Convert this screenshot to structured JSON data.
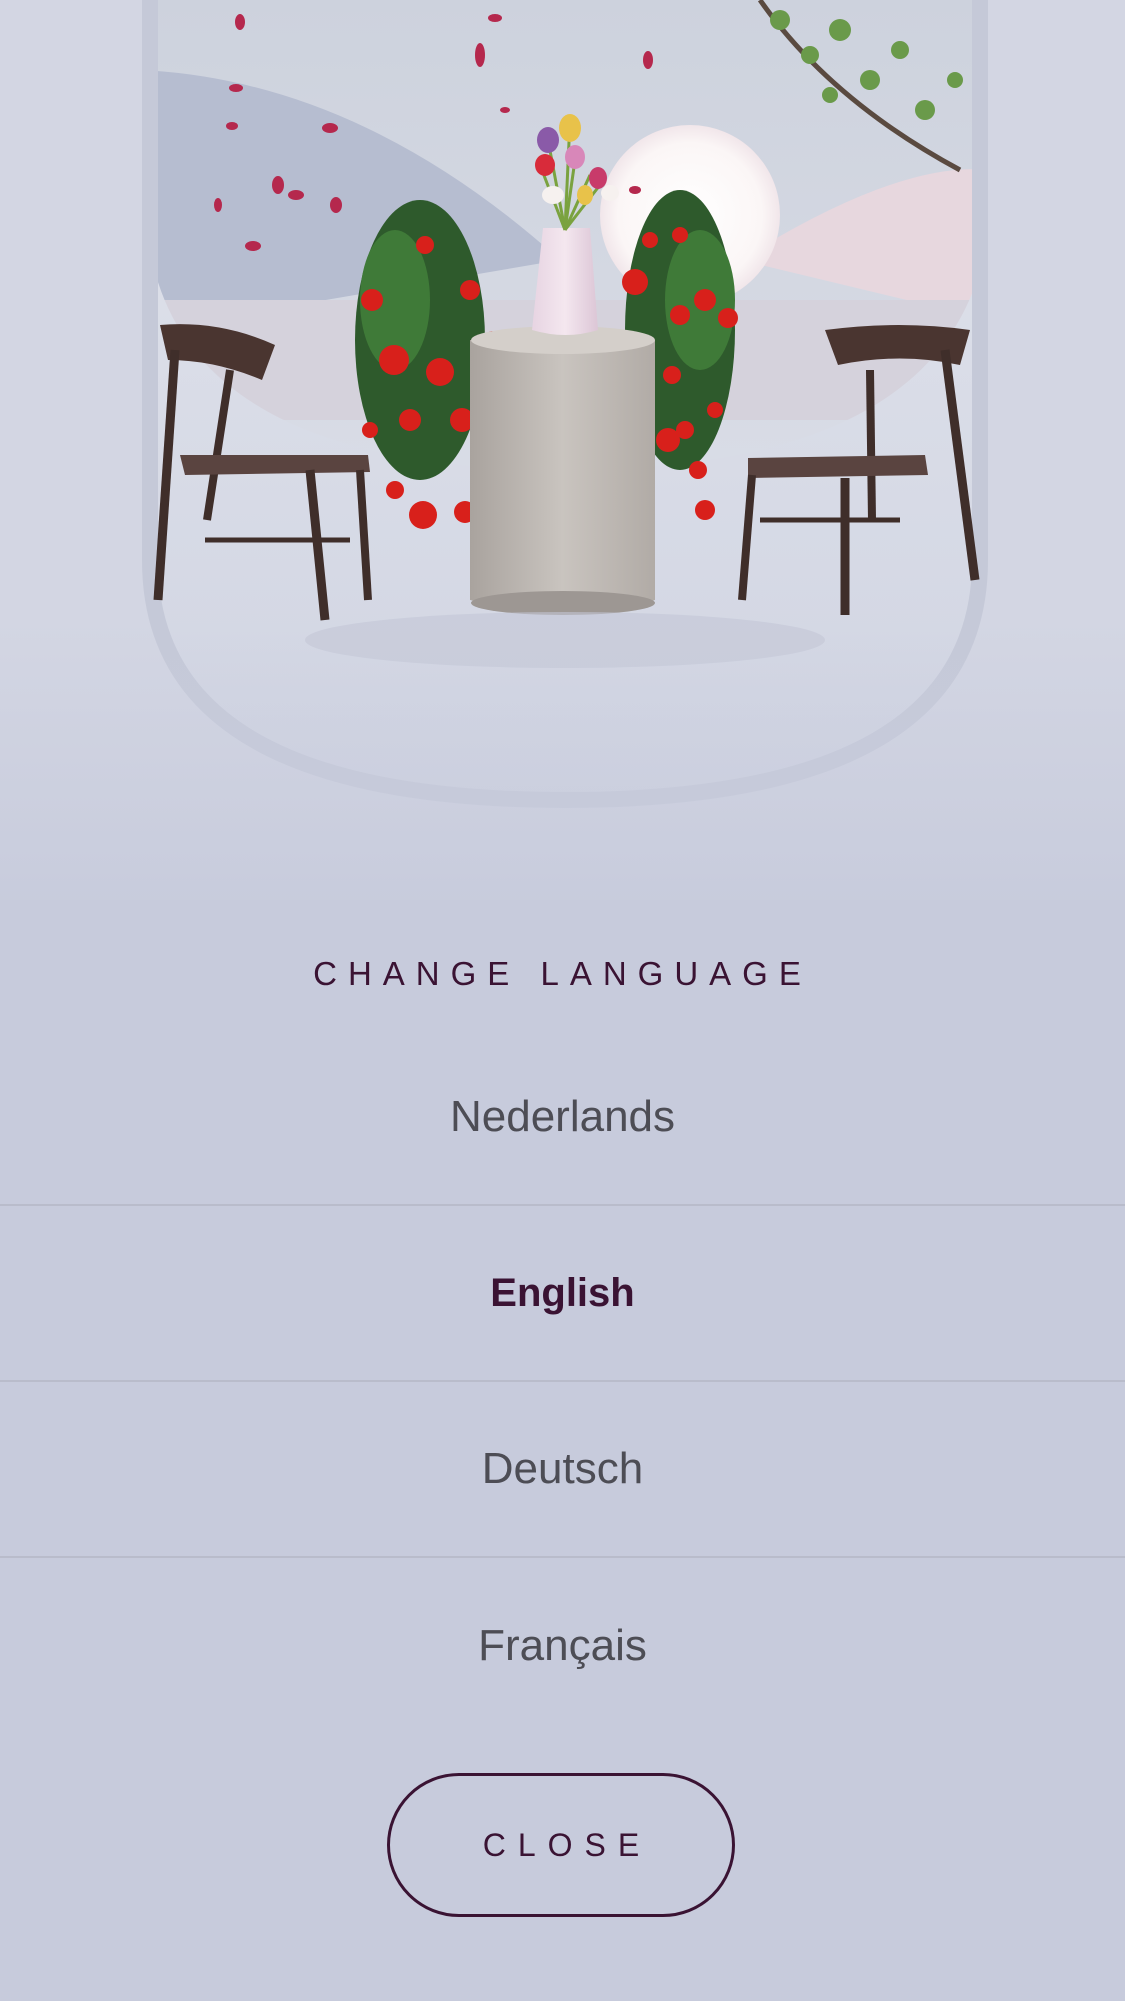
{
  "dialog": {
    "title": "CHANGE LANGUAGE",
    "languages": [
      {
        "label": "Nederlands",
        "selected": false
      },
      {
        "label": "English",
        "selected": true
      },
      {
        "label": "Deutsch",
        "selected": false
      },
      {
        "label": "Français",
        "selected": false
      }
    ],
    "close_label": "CLOSE"
  },
  "colors": {
    "accent": "#3a1333",
    "background": "#c7cbdc",
    "text_muted": "#4d4d55",
    "divider": "#b9bccb"
  },
  "hero": {
    "description_icon": "table-with-flowers-illustration"
  }
}
